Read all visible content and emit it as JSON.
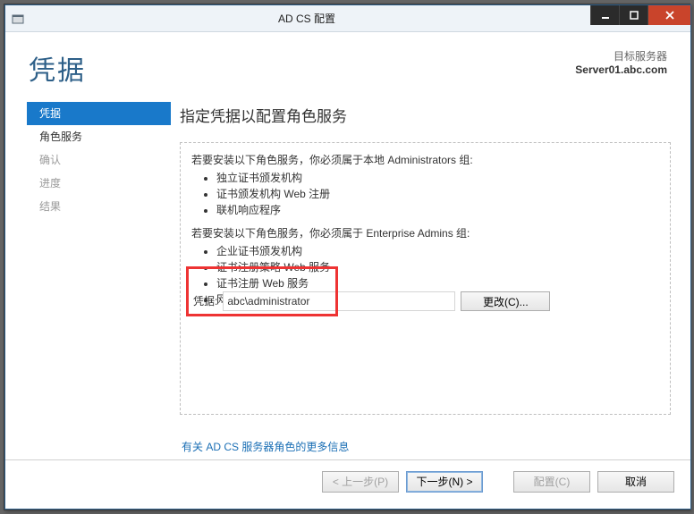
{
  "title": "AD CS 配置",
  "header": {
    "page_title": "凭据",
    "target_label": "目标服务器",
    "target_host": "Server01.abc.com"
  },
  "sidebar": {
    "items": [
      {
        "label": "凭据",
        "active": true
      },
      {
        "label": "角色服务",
        "active": false
      },
      {
        "label": "确认",
        "active": false
      },
      {
        "label": "进度",
        "active": false
      },
      {
        "label": "结果",
        "active": false
      }
    ]
  },
  "content": {
    "heading": "指定凭据以配置角色服务",
    "section1_intro": "若要安装以下角色服务，你必须属于本地 Administrators 组:",
    "section1_items": [
      "独立证书颁发机构",
      "证书颁发机构 Web 注册",
      "联机响应程序"
    ],
    "section2_intro": "若要安装以下角色服务，你必须属于 Enterprise Admins 组:",
    "section2_items": [
      "企业证书颁发机构",
      "证书注册策略 Web 服务",
      "证书注册 Web 服务",
      "网络设备注册服务"
    ],
    "cred_label": "凭据:",
    "cred_value": "abc\\administrator",
    "change_btn": "更改(C)...",
    "more_link": "有关 AD CS 服务器角色的更多信息"
  },
  "footer": {
    "prev": "< 上一步(P)",
    "next": "下一步(N) >",
    "configure": "配置(C)",
    "cancel": "取消"
  }
}
